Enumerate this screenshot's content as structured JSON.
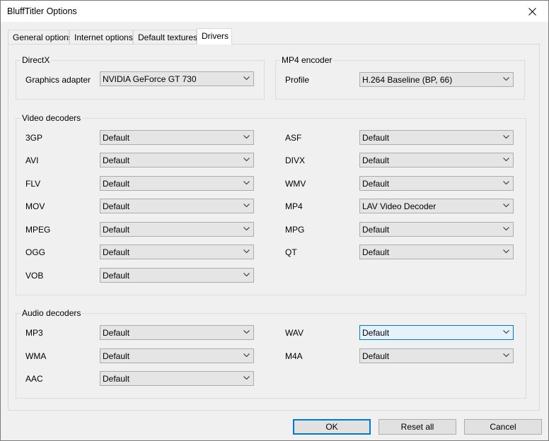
{
  "window": {
    "title": "BluffTitler Options"
  },
  "tabs": [
    {
      "label": "General options",
      "active": false
    },
    {
      "label": "Internet options",
      "active": false
    },
    {
      "label": "Default textures",
      "active": false
    },
    {
      "label": "Drivers",
      "active": true
    }
  ],
  "directx": {
    "group_label": "DirectX",
    "adapter_label": "Graphics adapter",
    "adapter_value": "NVIDIA GeForce GT 730"
  },
  "mp4": {
    "group_label": "MP4 encoder",
    "profile_label": "Profile",
    "profile_value": "H.264 Baseline (BP, 66)"
  },
  "video": {
    "group_label": "Video decoders",
    "left": [
      {
        "label": "3GP",
        "value": "Default"
      },
      {
        "label": "AVI",
        "value": "Default"
      },
      {
        "label": "FLV",
        "value": "Default"
      },
      {
        "label": "MOV",
        "value": "Default"
      },
      {
        "label": "MPEG",
        "value": "Default"
      },
      {
        "label": "OGG",
        "value": "Default"
      },
      {
        "label": "VOB",
        "value": "Default"
      }
    ],
    "right": [
      {
        "label": "ASF",
        "value": "Default"
      },
      {
        "label": "DIVX",
        "value": "Default"
      },
      {
        "label": "WMV",
        "value": "Default"
      },
      {
        "label": "MP4",
        "value": "LAV Video Decoder"
      },
      {
        "label": "MPG",
        "value": "Default"
      },
      {
        "label": "QT",
        "value": "Default"
      }
    ]
  },
  "audio": {
    "group_label": "Audio decoders",
    "left": [
      {
        "label": "MP3",
        "value": "Default"
      },
      {
        "label": "WMA",
        "value": "Default"
      },
      {
        "label": "AAC",
        "value": "Default"
      }
    ],
    "right": [
      {
        "label": "WAV",
        "value": "Default",
        "focused": true
      },
      {
        "label": "M4A",
        "value": "Default"
      }
    ]
  },
  "buttons": {
    "ok": "OK",
    "reset_all": "Reset all",
    "cancel": "Cancel"
  },
  "colors": {
    "focus_accent": "#0078d7",
    "focus_fill": "#e5f1fb"
  }
}
